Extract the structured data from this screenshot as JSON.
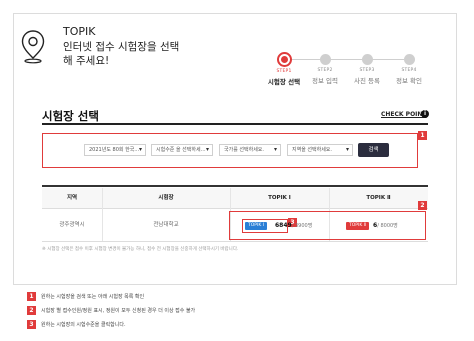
{
  "header": {
    "title": "TOPIK",
    "subtitle": "인터넷 접수 시험장을 선택해 주세요!"
  },
  "steps": [
    {
      "num": "STEP1",
      "label": "시험장 선택",
      "active": true
    },
    {
      "num": "STEP2",
      "label": "정보 입력",
      "active": false
    },
    {
      "num": "STEP3",
      "label": "사진 등록",
      "active": false
    },
    {
      "num": "STEP4",
      "label": "정보 확인",
      "active": false
    }
  ],
  "section": {
    "title": "시험장 선택",
    "check_point": "CHECK POINT",
    "info_icon": "i"
  },
  "search": {
    "selects": [
      "2021년도 80회 한국…",
      "시험수준 을 선택하세…",
      "국가를 선택하세요.",
      "지역을 선택하세요."
    ],
    "button": "검색"
  },
  "table": {
    "headers": [
      "지역",
      "시험장",
      "TOPIK Ⅰ",
      "TOPIK Ⅱ"
    ],
    "row": {
      "region": "광주광역시",
      "venue": "전남대학교",
      "topik1": {
        "tag": "TOPIK Ⅰ",
        "count": "6849",
        "total": "/ 3900명"
      },
      "topik2": {
        "tag": "TOPIK Ⅱ",
        "count": "6",
        "total": "/ 8000명"
      }
    },
    "note": "※ 시험장 선택은 접수 이후 시험장 변경이 불가능 하니, 접수 전 시험장을 신중하게 선택하시기 바랍니다."
  },
  "badges": [
    "1",
    "2",
    "3"
  ],
  "notes": [
    {
      "badge": "1",
      "text": "원하는 시험장을 검색 또는 아래 시험장 목록 확인"
    },
    {
      "badge": "2",
      "text": "시험장 별 접수인원/정원 표시, 정원이 모두 신청된 경우 더 이상 접수 불가"
    },
    {
      "badge": "3",
      "text": "원하는 시험장의 시험수준을 클릭합니다."
    }
  ],
  "colors": {
    "accent": "#e03b3b",
    "blue_tag": "#2b7fd6",
    "dark_button": "#2b2d3e"
  }
}
